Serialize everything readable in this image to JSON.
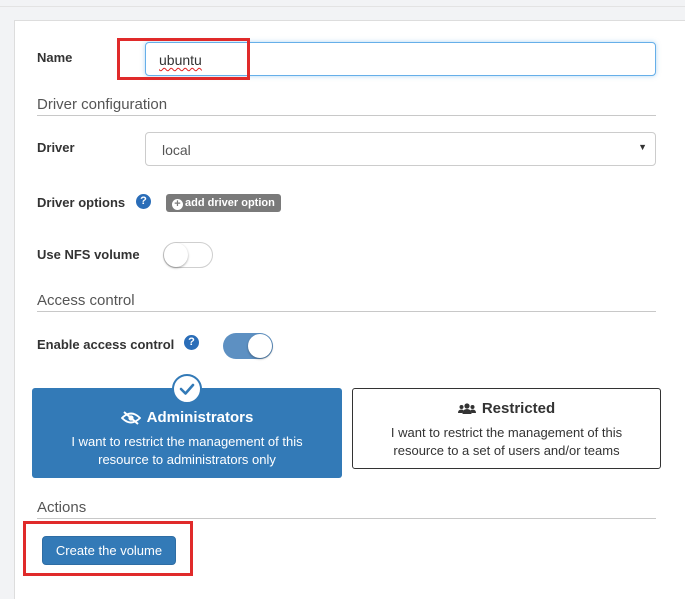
{
  "form": {
    "name_label": "Name",
    "name_value": "ubuntu",
    "driver_section": "Driver configuration",
    "driver_label": "Driver",
    "driver_value": "local",
    "driver_options_label": "Driver options",
    "add_driver_option": "add driver option",
    "nfs_label": "Use NFS volume",
    "nfs_enabled": false,
    "access_section": "Access control",
    "access_label": "Enable access control",
    "access_enabled": true,
    "options": [
      {
        "title": "Administrators",
        "desc_line1": "I want to restrict the management of this",
        "desc_line2": "resource to administrators only",
        "icon": "eye-slash-icon",
        "selected": true
      },
      {
        "title": "Restricted",
        "desc_line1": "I want to restrict the management of this",
        "desc_line2": "resource to a set of users and/or teams",
        "icon": "users-icon",
        "selected": false
      }
    ],
    "actions_section": "Actions",
    "create_button": "Create the volume"
  },
  "colors": {
    "primary": "#337ab7",
    "highlight": "#e02a2a",
    "toggle_on": "#5d90c2",
    "badge": "#7a7a7a"
  }
}
